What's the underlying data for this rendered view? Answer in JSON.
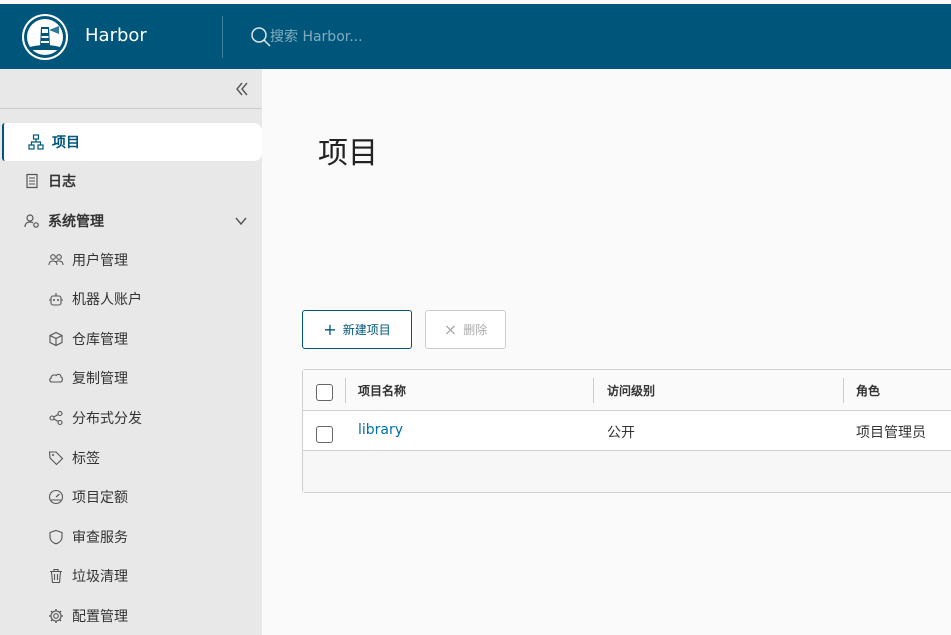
{
  "header": {
    "app_title": "Harbor",
    "search_placeholder": "搜索 Harbor...",
    "bg_color": "#00567a"
  },
  "sidebar": {
    "collapse_icon": "double-chevron-left-icon",
    "items": [
      {
        "label": "项目",
        "icon": "sitemap-icon",
        "active": true
      },
      {
        "label": "日志",
        "icon": "document-icon"
      },
      {
        "label": "系统管理",
        "icon": "user-cog-icon",
        "expanded": true
      },
      {
        "label": "用户管理",
        "icon": "users-icon"
      },
      {
        "label": "机器人账户",
        "icon": "robot-icon"
      },
      {
        "label": "仓库管理",
        "icon": "cube-icon"
      },
      {
        "label": "复制管理",
        "icon": "cloud-icon"
      },
      {
        "label": "分布式分发",
        "icon": "share-icon"
      },
      {
        "label": "标签",
        "icon": "tag-icon"
      },
      {
        "label": "项目定额",
        "icon": "gauge-icon"
      },
      {
        "label": "审查服务",
        "icon": "shield-icon"
      },
      {
        "label": "垃圾清理",
        "icon": "trash-icon"
      },
      {
        "label": "配置管理",
        "icon": "gear-icon"
      }
    ]
  },
  "main": {
    "page_title": "项目",
    "toolbar": {
      "new_label": "新建项目",
      "delete_label": "删除"
    },
    "table": {
      "columns": [
        "项目名称",
        "访问级别",
        "角色"
      ],
      "rows": [
        {
          "name": "library",
          "access": "公开",
          "role": "项目管理员"
        }
      ]
    },
    "accent_color": "#0072a3"
  }
}
